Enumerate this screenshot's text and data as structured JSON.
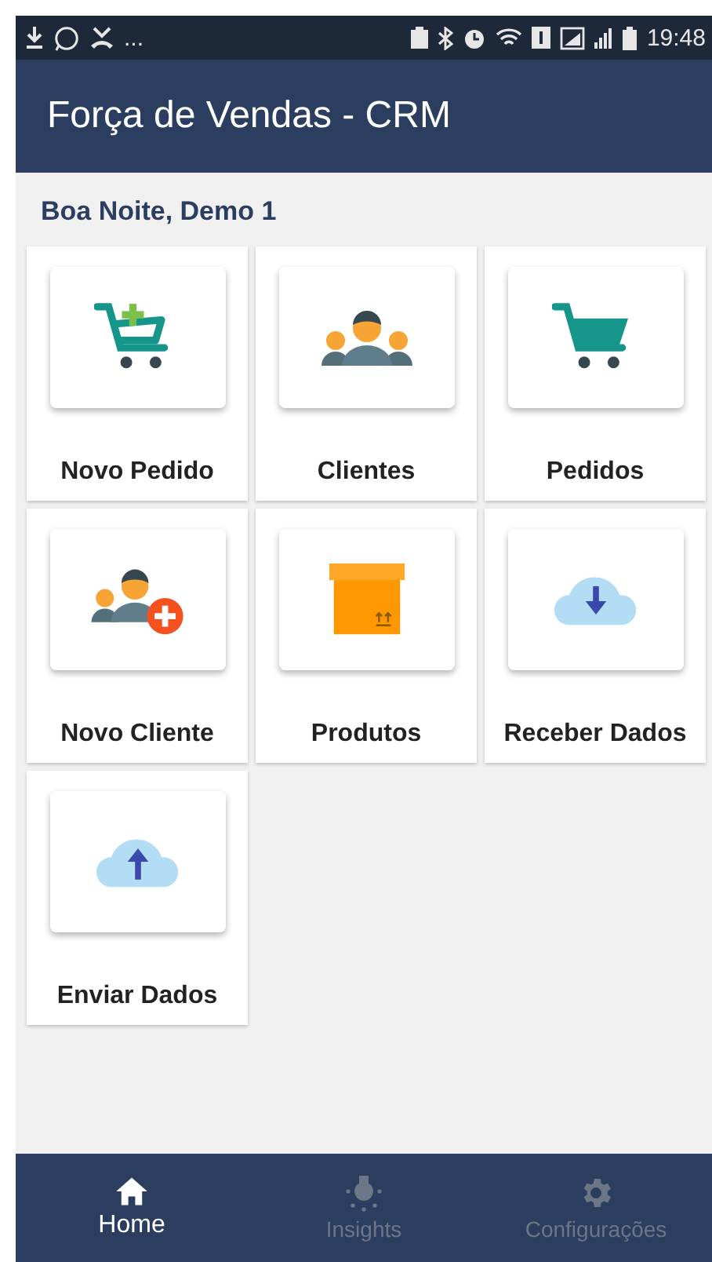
{
  "status_bar": {
    "overflow": "...",
    "time": "19:48"
  },
  "app_bar": {
    "title": "Força de Vendas - CRM"
  },
  "greeting": "Boa Noite, Demo 1",
  "tiles": [
    {
      "label": "Novo Pedido",
      "kind": "cart-plus"
    },
    {
      "label": "Clientes",
      "kind": "people"
    },
    {
      "label": "Pedidos",
      "kind": "cart"
    },
    {
      "label": "Novo Cliente",
      "kind": "people-plus"
    },
    {
      "label": "Produtos",
      "kind": "box"
    },
    {
      "label": "Receber Dados",
      "kind": "cloud-down"
    },
    {
      "label": "Enviar Dados",
      "kind": "cloud-up"
    }
  ],
  "bottom_nav": [
    {
      "label": "Home",
      "kind": "home",
      "selected": true
    },
    {
      "label": "Insights",
      "kind": "bulb",
      "selected": false
    },
    {
      "label": "Configurações",
      "kind": "gear",
      "selected": false
    }
  ]
}
